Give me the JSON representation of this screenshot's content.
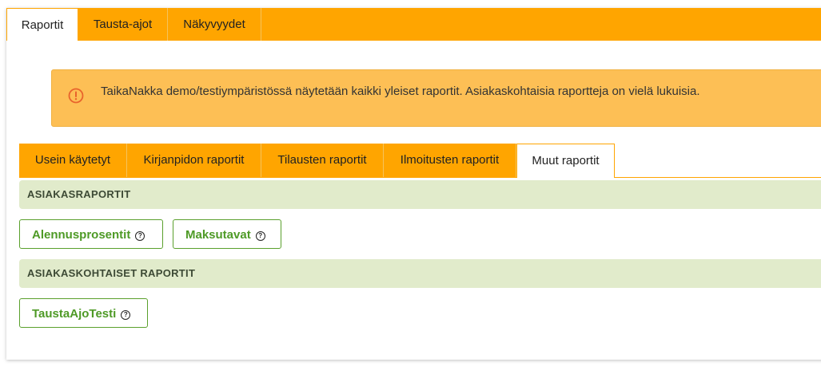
{
  "top_tabs": [
    {
      "label": "Raportit",
      "active": true
    },
    {
      "label": "Tausta-ajot",
      "active": false
    },
    {
      "label": "Näkyvyydet",
      "active": false
    }
  ],
  "notice": {
    "icon": "info-circle-icon",
    "text": "TaikaNakka demo/testiympäristössä näytetään kaikki yleiset raportit. Asiakaskohtaisia raportteja on vielä lukuisia."
  },
  "sub_tabs": [
    {
      "label": "Usein käytetyt",
      "active": false
    },
    {
      "label": "Kirjanpidon raportit",
      "active": false
    },
    {
      "label": "Tilausten raportit",
      "active": false
    },
    {
      "label": "Ilmoitusten raportit",
      "active": false
    },
    {
      "label": "Muut raportit",
      "active": true
    }
  ],
  "sections": [
    {
      "title": "ASIAKASRAPORTIT",
      "reports": [
        "Alennusprosentit",
        "Maksutavat"
      ]
    },
    {
      "title": "ASIAKASKOHTAISET RAPORTIT",
      "reports": [
        "TaustaAjoTesti"
      ]
    }
  ],
  "colors": {
    "tab_bar": "#ffa500",
    "notice_bg": "#fdbf55",
    "section_bg": "#e1ebcb",
    "report_text": "#4e9a26"
  },
  "help_glyph": "?"
}
